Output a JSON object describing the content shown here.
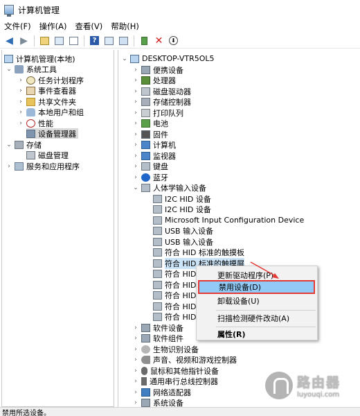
{
  "window": {
    "title": "计算机管理"
  },
  "menubar": [
    "文件(F)",
    "操作(A)",
    "查看(V)",
    "帮助(H)"
  ],
  "left_tree": {
    "root": "计算机管理(本地)",
    "system_tools": "系统工具",
    "task_scheduler": "任务计划程序",
    "event_viewer": "事件查看器",
    "shared_folders": "共享文件夹",
    "local_users": "本地用户和组",
    "performance": "性能",
    "device_manager": "设备管理器",
    "storage": "存储",
    "disk_management": "磁盘管理",
    "services": "服务和应用程序"
  },
  "right_tree": {
    "computer": "DESKTOP-VTR5OL5",
    "categories_top": [
      "便携设备",
      "处理器",
      "磁盘驱动器",
      "存储控制器",
      "打印队列",
      "电池",
      "固件",
      "计算机",
      "监视器",
      "键盘",
      "蓝牙"
    ],
    "hid_category": "人体学输入设备",
    "hid_children": [
      "I2C HID 设备",
      "I2C HID 设备",
      "Microsoft Input Configuration Device",
      "USB 输入设备",
      "USB 输入设备",
      "符合 HID 标准的触摸板",
      "符合 HID 标准的触摸屏",
      "符合 HID",
      "符合 HID",
      "符合 HID",
      "符合 HID",
      "符合 HID"
    ],
    "categories_bottom": [
      "软件设备",
      "软件组件",
      "生物识别设备",
      "声音、视频和游戏控制器",
      "鼠标和其他指针设备",
      "通用串行总线控制器",
      "网络适配器",
      "系统设备"
    ]
  },
  "context_menu": {
    "update_driver": "更新驱动程序(P)",
    "disable_device": "禁用设备(D)",
    "uninstall_device": "卸载设备(U)",
    "scan_hardware": "扫描检测硬件改动(A)",
    "properties": "属性(R)"
  },
  "status_text": "禁用所选设备。",
  "watermark": {
    "cn": "路由器",
    "en": "luyouqi.com"
  },
  "colors": {
    "menu_highlight": "#91c9f7",
    "annotation_red": "#e53935",
    "selection": "#cce4f7"
  }
}
